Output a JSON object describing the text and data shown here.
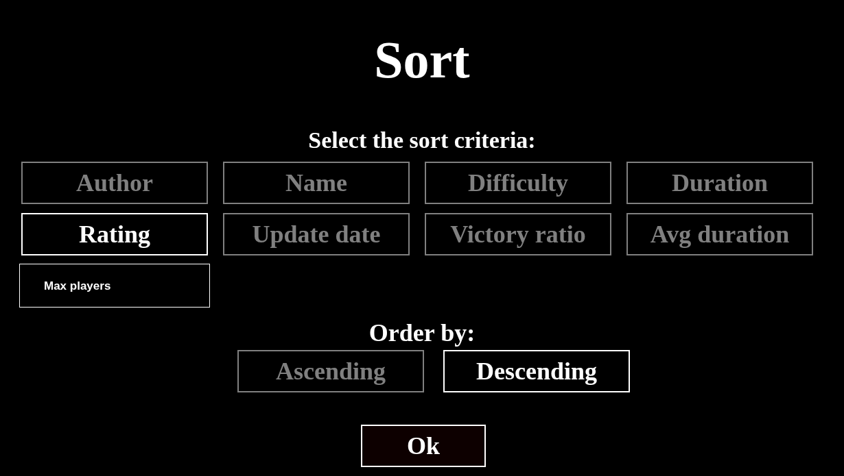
{
  "title": "Sort",
  "criteria_label": "Select the sort criteria:",
  "criteria": [
    {
      "label": "Author",
      "kind": "styled",
      "selected": false
    },
    {
      "label": "Name",
      "kind": "styled",
      "selected": false
    },
    {
      "label": "Difficulty",
      "kind": "styled",
      "selected": false
    },
    {
      "label": "Duration",
      "kind": "styled",
      "selected": false
    },
    {
      "label": "Rating",
      "kind": "styled",
      "selected": true
    },
    {
      "label": "Update date",
      "kind": "styled",
      "selected": false
    },
    {
      "label": "Victory ratio",
      "kind": "styled",
      "selected": false
    },
    {
      "label": "Avg duration",
      "kind": "styled",
      "selected": false
    },
    {
      "label": "Max players",
      "kind": "plain",
      "selected": false
    }
  ],
  "order_label": "Order by:",
  "order": [
    {
      "label": "Ascending",
      "selected": false
    },
    {
      "label": "Descending",
      "selected": true
    }
  ],
  "ok_button": "Ok"
}
